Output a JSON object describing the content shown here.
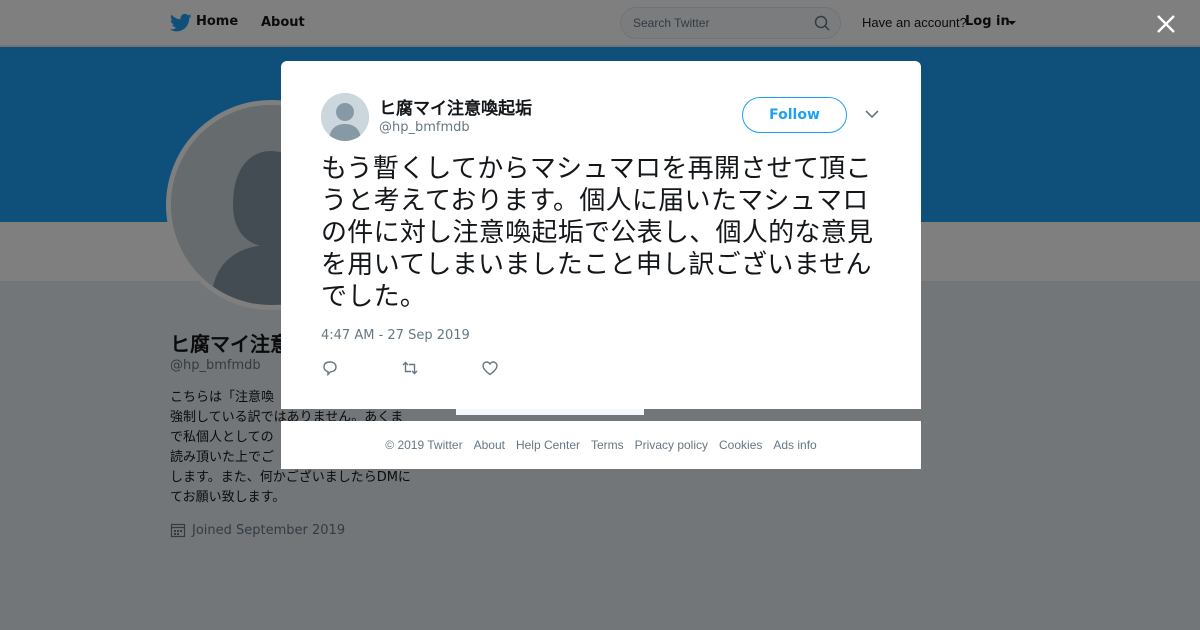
{
  "nav": {
    "home_label": "Home",
    "about_label": "About",
    "search_placeholder": "Search Twitter",
    "have_account": "Have an account?",
    "login_label": "Log in"
  },
  "profile": {
    "name": "ヒ腐マイ注意喚起垢",
    "handle": "@hp_bmfmdb",
    "bio_lines": [
      "こちらは「注意喚",
      "強制している訳ではありません。あくま",
      "で私個人としての",
      "読み頂いた上でご",
      "します。また、何かございましたらDMに",
      "てお願い致します。"
    ],
    "joined": "Joined September 2019"
  },
  "tweet": {
    "name": "ヒ腐マイ注意喚起垢",
    "handle": "@hp_bmfmdb",
    "follow_label": "Follow",
    "text": "もう暫くしてからマシュマロを再開させて頂こうと考えております。個人に届いたマシュマロの件に対し注意喚起垢で公表し、個人的な意見を用いてしまいましたこと申し訳ございませんでした。",
    "timestamp": "4:47 AM - 27 Sep 2019"
  },
  "footer": {
    "copyright": "© 2019 Twitter",
    "links": [
      "About",
      "Help Center",
      "Terms",
      "Privacy policy",
      "Cookies",
      "Ads info"
    ]
  },
  "colors": {
    "brand": "#1da1f2",
    "text": "#14171a",
    "secondary": "#657786"
  },
  "icons": [
    "twitter-bird-icon",
    "search-icon",
    "close-icon",
    "calendar-icon",
    "chevron-down-icon",
    "reply-icon",
    "retweet-icon",
    "like-icon"
  ]
}
